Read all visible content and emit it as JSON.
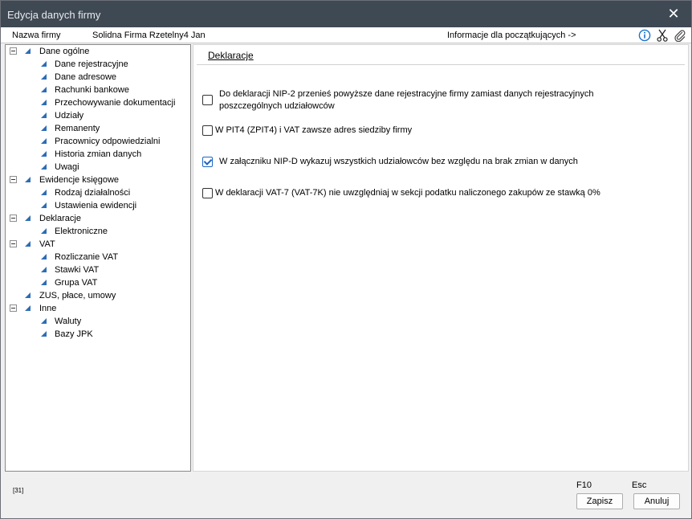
{
  "window": {
    "title": "Edycja danych firmy"
  },
  "infobar": {
    "name_label": "Nazwa firmy",
    "name_value": "Solidna Firma Rzetelny4 Jan",
    "beginners_link": "Informacje dla początkujących ->",
    "icons": [
      "info-icon",
      "scissors-icon",
      "paperclip-icon"
    ]
  },
  "tree": {
    "groups": [
      {
        "label": "Dane ogólne",
        "children": [
          "Dane rejestracyjne",
          "Dane adresowe",
          "Rachunki bankowe",
          "Przechowywanie dokumentacji",
          "Udziały",
          "Remanenty",
          "Pracownicy odpowiedzialni",
          "Historia zmian danych",
          "Uwagi"
        ]
      },
      {
        "label": "Ewidencje księgowe",
        "children": [
          "Rodzaj działalności",
          "Ustawienia ewidencji"
        ]
      },
      {
        "label": "Deklaracje",
        "children": [
          "Elektroniczne"
        ]
      },
      {
        "label": "VAT",
        "children": [
          "Rozliczanie VAT",
          "Stawki VAT",
          "Grupa VAT"
        ]
      },
      {
        "label": "ZUS, płace, umowy",
        "children": []
      },
      {
        "label": "Inne",
        "children": [
          "Waluty",
          "Bazy JPK"
        ]
      }
    ]
  },
  "content": {
    "section_title": "Deklaracje",
    "options": [
      {
        "line1": "Do deklaracji NIP-2 przenieś powyższe dane rejestracyjne firmy zamiast danych rejestracyjnych",
        "line2": "poszczególnych udziałowców",
        "checked": false
      },
      {
        "line1": "W PIT4 (ZPIT4) i  VAT zawsze adres siedziby firmy",
        "line2": "",
        "checked": false
      },
      {
        "line1": "W załączniku NIP-D wykazuj wszystkich udziałowców bez względu na brak zmian w danych",
        "line2": "",
        "checked": true
      },
      {
        "line1": "W deklaracji VAT-7 (VAT-7K) nie uwzględniaj w sekcji podatku naliczonego zakupów ze stawką 0%",
        "line2": "",
        "checked": false
      }
    ]
  },
  "footer": {
    "code": "[31]",
    "save_key": "F10",
    "cancel_key": "Esc",
    "save_label": "Zapisz",
    "cancel_label": "Anuluj"
  },
  "colors": {
    "titlebar": "#3f4954",
    "tree_triangle": "#2d6db5",
    "checkbox_accent": "#1f66c2",
    "info_icon": "#1a73c9"
  }
}
